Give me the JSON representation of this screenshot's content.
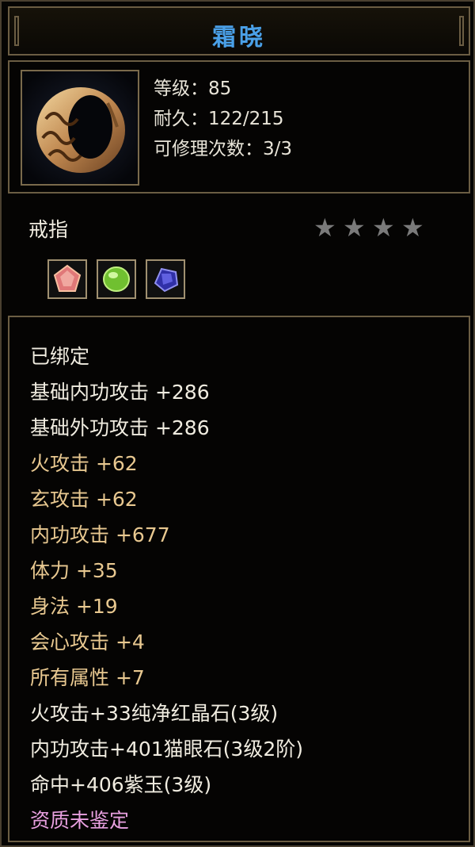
{
  "item": {
    "name": "霜晓",
    "level_line": "等级：85",
    "durability_line": "耐久：122/215",
    "repair_line": "可修理次数：3/3",
    "type": "戒指",
    "stars": [
      "★",
      "★",
      "★",
      "★"
    ]
  },
  "gems": [
    "red-gem-icon",
    "green-gem-icon",
    "purple-gem-icon"
  ],
  "attributes": [
    {
      "text": "已绑定",
      "color": "white"
    },
    {
      "text": "基础内功攻击  +286",
      "color": "white"
    },
    {
      "text": "基础外功攻击  +286",
      "color": "white"
    },
    {
      "text": "火攻击  +62",
      "color": "gold"
    },
    {
      "text": "玄攻击  +62",
      "color": "gold"
    },
    {
      "text": "内功攻击  +677",
      "color": "gold"
    },
    {
      "text": "体力  +35",
      "color": "gold"
    },
    {
      "text": "身法  +19",
      "color": "gold"
    },
    {
      "text": "会心攻击  +4",
      "color": "gold"
    },
    {
      "text": "所有属性  +7",
      "color": "gold"
    },
    {
      "text": "火攻击+33纯净红晶石(3级)",
      "color": "white"
    },
    {
      "text": "内功攻击+401猫眼石(3级2阶)",
      "color": "white"
    },
    {
      "text": "命中+406紫玉(3级)",
      "color": "white"
    },
    {
      "text": "资质未鉴定",
      "color": "pink"
    }
  ],
  "colors": {
    "title": "#4aa0e8",
    "gold": "#e8c890",
    "white": "#f0ece0",
    "pink": "#e8a0e0",
    "border": "#6b5d43"
  }
}
